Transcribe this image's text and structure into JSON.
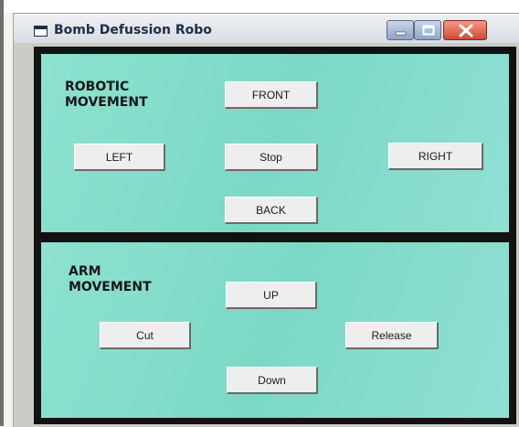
{
  "window": {
    "title": "Bomb Defussion Robo"
  },
  "window_controls": {
    "minimize_icon": "minimize-icon",
    "maximize_icon": "maximize-icon",
    "close_icon": "close-icon"
  },
  "robotic_movement": {
    "heading_line1": "ROBOTIC",
    "heading_line2": "MOVEMENT",
    "front_label": "FRONT",
    "left_label": "LEFT",
    "stop_label": "Stop",
    "right_label": "RIGHT",
    "back_label": "BACK"
  },
  "arm_movement": {
    "heading_line1": "ARM",
    "heading_line2": "MOVEMENT",
    "up_label": "UP",
    "cut_label": "Cut",
    "release_label": "Release",
    "down_label": "Down"
  },
  "colors": {
    "panel_background": "#7fdcc8",
    "frame_border": "#121212",
    "close_button": "#d24a31"
  }
}
